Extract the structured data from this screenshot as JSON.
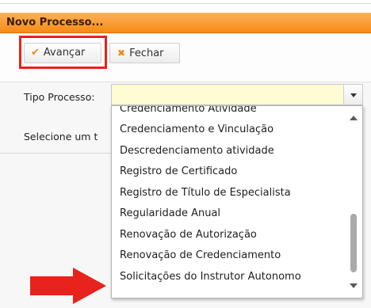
{
  "dialog": {
    "title": "Novo Processo..."
  },
  "toolbar": {
    "advance_label": "Avançar",
    "close_label": "Fechar"
  },
  "form": {
    "tipo_label": "Tipo Processo:",
    "tipo_value": "",
    "selecione_text": "Selecione um t"
  },
  "dropdown": {
    "options": [
      "Credenciamento Atividade",
      "Credenciamento e Vinculação",
      "Descredenciamento atividade",
      "Registro de Certificado",
      "Registro de Título de Especialista",
      "Regularidade Anual",
      "Renovação de Autorização",
      "Renovação de Credenciamento",
      "Solicitações do Instrutor Autonomo"
    ]
  },
  "colors": {
    "titlebar": "#f68a14",
    "highlight_box": "#e8221c",
    "pointer_arrow": "#e8221c",
    "combo_background": "#fffbd2"
  },
  "icons": {
    "advance": "check-icon",
    "close": "x-icon",
    "combo": "chevron-down-icon"
  }
}
